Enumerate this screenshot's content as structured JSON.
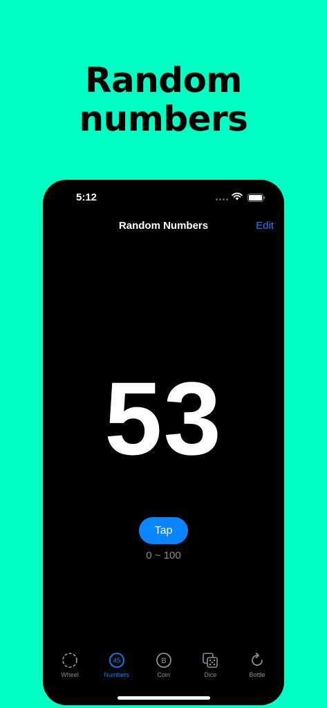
{
  "promo": {
    "title_line1": "Random",
    "title_line2": "numbers"
  },
  "status_bar": {
    "time": "5:12"
  },
  "nav": {
    "title": "Random Numbers",
    "edit_label": "Edit"
  },
  "main": {
    "number": "53",
    "tap_label": "Tap",
    "range": "0 ~ 100"
  },
  "tabs": [
    {
      "label": "Wheel",
      "icon": "wheel-icon",
      "active": false
    },
    {
      "label": "Numbers",
      "icon": "numbers-icon",
      "icon_text": "45",
      "active": true
    },
    {
      "label": "Coin",
      "icon": "coin-icon",
      "icon_text": "B",
      "active": false
    },
    {
      "label": "Dice",
      "icon": "dice-icon",
      "active": false
    },
    {
      "label": "Bottle",
      "icon": "bottle-icon",
      "active": false
    }
  ],
  "colors": {
    "background": "#00FFC3",
    "accent": "#0A84FF",
    "inactive": "#8e8e93"
  }
}
